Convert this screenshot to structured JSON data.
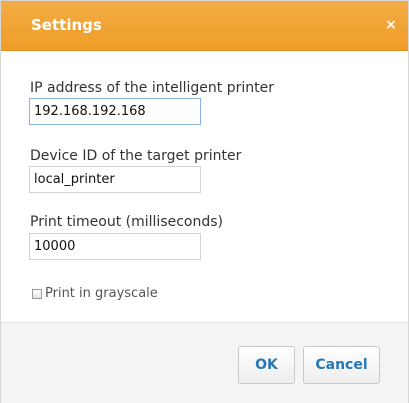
{
  "dialog": {
    "title": "Settings",
    "close_glyph": "×",
    "close_icon": "close-icon"
  },
  "fields": {
    "ip_address": {
      "label": "IP address of the intelligent printer",
      "value": "192.168.192.168"
    },
    "device_id": {
      "label": "Device ID of the target printer",
      "value": "local_printer"
    },
    "print_timeout": {
      "label": "Print timeout (milliseconds)",
      "value": "10000"
    }
  },
  "grayscale": {
    "label": "Print in grayscale",
    "checked": false
  },
  "buttons": {
    "ok_label": "OK",
    "cancel_label": "Cancel"
  },
  "colors": {
    "titlebar": "#f0a231",
    "button_text": "#2777b7",
    "footer": "#f4f4f4"
  }
}
